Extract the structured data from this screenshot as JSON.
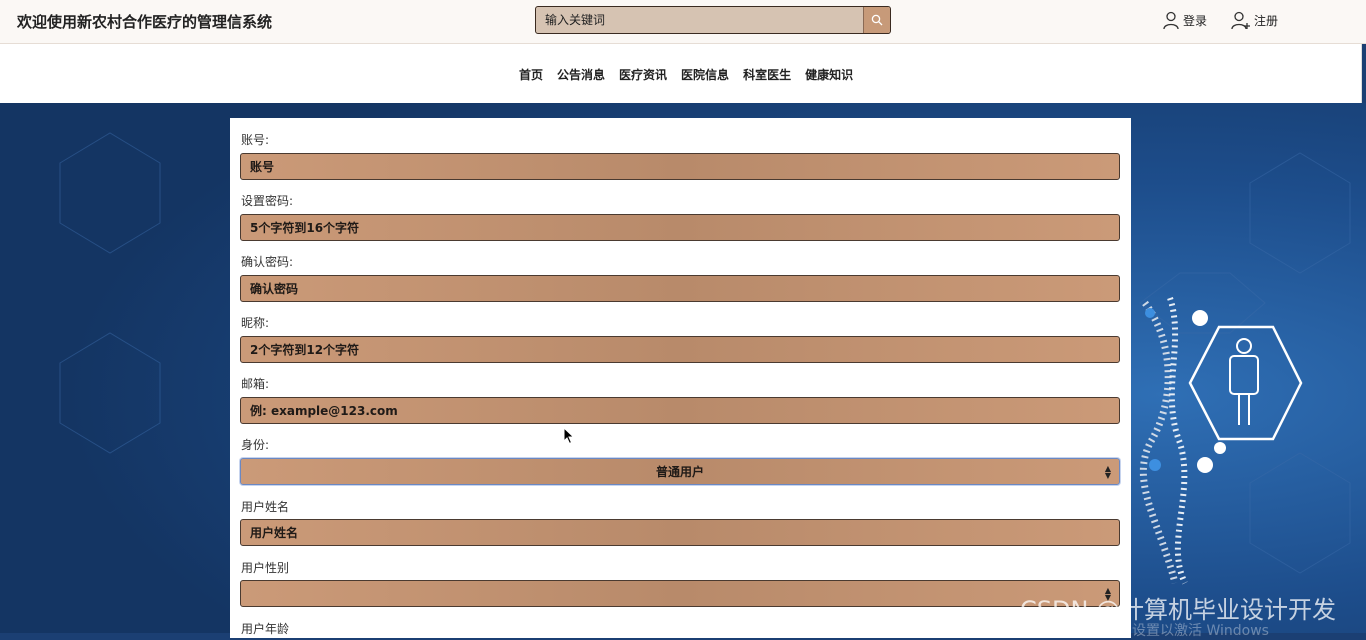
{
  "header": {
    "site_title": "欢迎使用新农村合作医疗的管理信系统",
    "search_placeholder": "输入关键词",
    "login_label": "登录",
    "register_label": "注册"
  },
  "nav": {
    "items": [
      "首页",
      "公告消息",
      "医疗资讯",
      "医院信息",
      "科室医生",
      "健康知识"
    ]
  },
  "form": {
    "fields": [
      {
        "label": "账号:",
        "placeholder": "账号"
      },
      {
        "label": "设置密码:",
        "placeholder": "5个字符到16个字符"
      },
      {
        "label": "确认密码:",
        "placeholder": "确认密码"
      },
      {
        "label": "昵称:",
        "placeholder": "2个字符到12个字符"
      },
      {
        "label": "邮箱:",
        "placeholder": "例: example@123.com"
      },
      {
        "label": "身份:",
        "selected": "普通用户"
      },
      {
        "label": "用户姓名",
        "placeholder": "用户姓名"
      },
      {
        "label": "用户性别",
        "selected": ""
      },
      {
        "label": "用户年龄"
      }
    ]
  },
  "watermark": {
    "text": "CSDN @计算机毕业设计开发",
    "sub": "转到设置以激活 Windows"
  },
  "colors": {
    "field_fill": "#c0906e",
    "background": "#1b3f73",
    "header_bg": "#fbf8f5"
  }
}
